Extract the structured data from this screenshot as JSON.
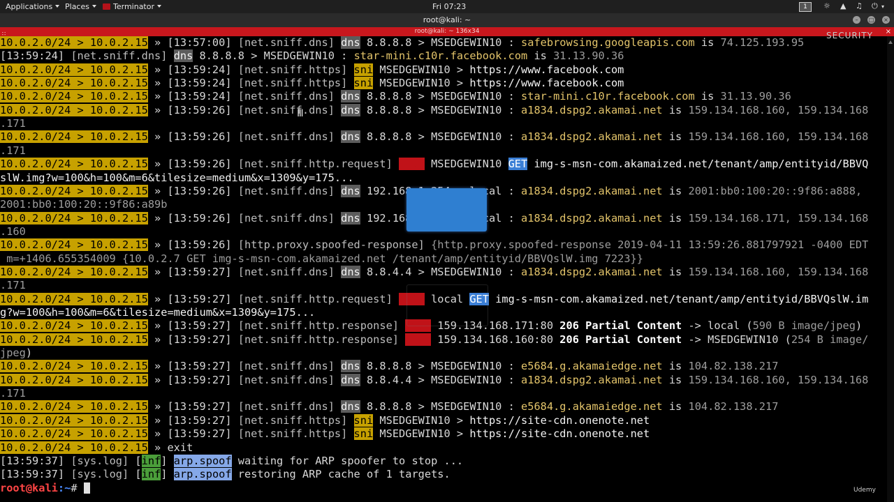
{
  "panel": {
    "applications": "Applications",
    "places": "Places",
    "terminator": "Terminator",
    "clock": "Fri 07:23",
    "workspace": "1"
  },
  "window": {
    "title": "root@kali: ~",
    "tab_title": "root@kali: ~ 136x34"
  },
  "watermark": "SECURITY",
  "udemy": "Udemy",
  "terminal_lines": [
    [
      [
        "ip",
        "10.0.2.0/24 > 10.0.2.15"
      ],
      [
        "t",
        " » [13:57:00] "
      ],
      [
        "tag",
        "[net.sniff.dns]"
      ],
      [
        "t",
        " "
      ],
      [
        "dnsb",
        "dns"
      ],
      [
        "t",
        " 8.8.8.8 > MSEDGEWIN10 : "
      ],
      [
        "host",
        "safebrowsing.googleapis.com"
      ],
      [
        "t",
        " is "
      ],
      [
        "ipg",
        "74.125.193.95"
      ]
    ],
    [
      [
        "t",
        "[13:59:24] "
      ],
      [
        "tag",
        "[net.sniff.dns]"
      ],
      [
        "t",
        " "
      ],
      [
        "dnsb",
        "dns"
      ],
      [
        "t",
        " 8.8.8.8 > MSEDGEWIN10 : "
      ],
      [
        "host",
        "star-mini.c10r.facebook.com"
      ],
      [
        "t",
        " is "
      ],
      [
        "ipg",
        "31.13.90.36"
      ]
    ],
    [
      [
        "ip",
        "10.0.2.0/24 > 10.0.2.15"
      ],
      [
        "t",
        " » [13:59:24] "
      ],
      [
        "tag",
        "[net.sniff.https]"
      ],
      [
        "t",
        " "
      ],
      [
        "snib",
        "sni"
      ],
      [
        "t",
        " MSEDGEWIN10 > "
      ],
      [
        "url",
        "https://www.facebook.com"
      ]
    ],
    [
      [
        "ip",
        "10.0.2.0/24 > 10.0.2.15"
      ],
      [
        "t",
        " » [13:59:24] "
      ],
      [
        "tag",
        "[net.sniff.https]"
      ],
      [
        "t",
        " "
      ],
      [
        "snib",
        "sni"
      ],
      [
        "t",
        " MSEDGEWIN10 > "
      ],
      [
        "url",
        "https://www.facebook.com"
      ]
    ],
    [
      [
        "ip",
        "10.0.2.0/24 > 10.0.2.15"
      ],
      [
        "t",
        " » [13:59:24] "
      ],
      [
        "tag",
        "[net.sniff.dns]"
      ],
      [
        "t",
        " "
      ],
      [
        "dnsb",
        "dns"
      ],
      [
        "t",
        " 8.8.8.8 > MSEDGEWIN10 : "
      ],
      [
        "host",
        "star-mini.c10r.facebook.com"
      ],
      [
        "t",
        " is "
      ],
      [
        "ipg",
        "31.13.90.36"
      ]
    ],
    [
      [
        "ip",
        "10.0.2.0/24 > 10.0.2.15"
      ],
      [
        "t",
        " » [13:59:26] "
      ],
      [
        "tag",
        "[net.sniff.dns]"
      ],
      [
        "t",
        " "
      ],
      [
        "dnsb",
        "dns"
      ],
      [
        "t",
        " 8.8.8.8 > MSEDGEWIN10 : "
      ],
      [
        "host",
        "a1834.dspg2.akamai.net"
      ],
      [
        "t",
        " is "
      ],
      [
        "ipg",
        "159.134.168.160, 159.134.168"
      ]
    ],
    [
      [
        "ipg",
        ".171"
      ]
    ],
    [
      [
        "ip",
        "10.0.2.0/24 > 10.0.2.15"
      ],
      [
        "t",
        " » [13:59:26] "
      ],
      [
        "tag",
        "[net.sniff.dns]"
      ],
      [
        "t",
        " "
      ],
      [
        "dnsb",
        "dns"
      ],
      [
        "t",
        " 8.8.8.8 > MSEDGEWIN10 : "
      ],
      [
        "host",
        "a1834.dspg2.akamai.net"
      ],
      [
        "t",
        " is "
      ],
      [
        "ipg",
        "159.134.168.160, 159.134.168"
      ]
    ],
    [
      [
        "ipg",
        ".171"
      ]
    ],
    [
      [
        "ip",
        "10.0.2.0/24 > 10.0.2.15"
      ],
      [
        "t",
        " » [13:59:26] "
      ],
      [
        "tag",
        "[net.sniff.http.request]"
      ],
      [
        "t",
        " "
      ],
      [
        "redb",
        "http"
      ],
      [
        "t",
        " MSEDGEWIN10 "
      ],
      [
        "getb",
        "GET"
      ],
      [
        "t",
        " "
      ],
      [
        "url",
        "img-s-msn-com.akamaized.net/tenant/amp/entityid/BBVQ"
      ]
    ],
    [
      [
        "url",
        "slW.img?w=100&h=100&m=6&tilesize=medium&x=1309&y=175..."
      ]
    ],
    [
      [
        "ip",
        "10.0.2.0/24 > 10.0.2.15"
      ],
      [
        "t",
        " » [13:59:26] "
      ],
      [
        "tag",
        "[net.sniff.dns]"
      ],
      [
        "t",
        " "
      ],
      [
        "dnsb",
        "dns"
      ],
      [
        "t",
        " 192.168.1.254 > local : "
      ],
      [
        "host",
        "a1834.dspg2.akamai.net"
      ],
      [
        "t",
        " is "
      ],
      [
        "ipg",
        "2001:bb0:100:20::9f86:a888,"
      ]
    ],
    [
      [
        "ipg",
        "2001:bb0:100:20::9f86:a89b"
      ]
    ],
    [
      [
        "ip",
        "10.0.2.0/24 > 10.0.2.15"
      ],
      [
        "t",
        " » [13:59:26] "
      ],
      [
        "tag",
        "[net.sniff.dns]"
      ],
      [
        "t",
        " "
      ],
      [
        "dnsb",
        "dns"
      ],
      [
        "t",
        " 192.168.1.254 > local : "
      ],
      [
        "host",
        "a1834.dspg2.akamai.net"
      ],
      [
        "t",
        " is "
      ],
      [
        "ipg",
        "159.134.168.171, 159.134.168"
      ]
    ],
    [
      [
        "ipg",
        ".160"
      ]
    ],
    [
      [
        "ip",
        "10.0.2.0/24 > 10.0.2.15"
      ],
      [
        "t",
        " » [13:59:26] "
      ],
      [
        "tag",
        "[http.proxy.spoofed-response]"
      ],
      [
        "t",
        " "
      ],
      [
        "ipg",
        "{http.proxy.spoofed-response 2019-04-11 13:59:26.881797921 -0400 EDT"
      ]
    ],
    [
      [
        "ipg",
        " m=+1406.655354009 {10.0.2.7 GET img-s-msn-com.akamaized.net /tenant/amp/entityid/BBVQslW.img 7223}}"
      ]
    ],
    [
      [
        "ip",
        "10.0.2.0/24 > 10.0.2.15"
      ],
      [
        "t",
        " » [13:59:27] "
      ],
      [
        "tag",
        "[net.sniff.dns]"
      ],
      [
        "t",
        " "
      ],
      [
        "dnsb",
        "dns"
      ],
      [
        "t",
        " 8.8.4.4 > MSEDGEWIN10 : "
      ],
      [
        "host",
        "a1834.dspg2.akamai.net"
      ],
      [
        "t",
        " is "
      ],
      [
        "ipg",
        "159.134.168.160, 159.134.168"
      ]
    ],
    [
      [
        "ipg",
        ".171"
      ]
    ],
    [
      [
        "ip",
        "10.0.2.0/24 > 10.0.2.15"
      ],
      [
        "t",
        " » [13:59:27] "
      ],
      [
        "tag",
        "[net.sniff.http.request]"
      ],
      [
        "t",
        " "
      ],
      [
        "redb",
        "http"
      ],
      [
        "t",
        " local "
      ],
      [
        "getb",
        "GET"
      ],
      [
        "t",
        " "
      ],
      [
        "url",
        "img-s-msn-com.akamaized.net/tenant/amp/entityid/BBVQslW.im"
      ]
    ],
    [
      [
        "url",
        "g?w=100&h=100&m=6&tilesize=medium&x=1309&y=175..."
      ]
    ],
    [
      [
        "ip",
        "10.0.2.0/24 > 10.0.2.15"
      ],
      [
        "t",
        " » [13:59:27] "
      ],
      [
        "tag",
        "[net.sniff.http.response]"
      ],
      [
        "t",
        " "
      ],
      [
        "redb",
        "http"
      ],
      [
        "t",
        " 159.134.168.171:80 "
      ],
      [
        "bold",
        "206 Partial Content"
      ],
      [
        "t",
        " -> local ("
      ],
      [
        "ipg",
        "590 B image/jpeg"
      ],
      [
        "t",
        ")"
      ]
    ],
    [
      [
        "ip",
        "10.0.2.0/24 > 10.0.2.15"
      ],
      [
        "t",
        " » [13:59:27] "
      ],
      [
        "tag",
        "[net.sniff.http.response]"
      ],
      [
        "t",
        " "
      ],
      [
        "redb",
        "http"
      ],
      [
        "t",
        " 159.134.168.160:80 "
      ],
      [
        "bold",
        "206 Partial Content"
      ],
      [
        "t",
        " -> MSEDGEWIN10 ("
      ],
      [
        "ipg",
        "254 B image/"
      ]
    ],
    [
      [
        "ipg",
        "jpeg"
      ],
      [
        "t",
        ")"
      ]
    ],
    [
      [
        "ip",
        "10.0.2.0/24 > 10.0.2.15"
      ],
      [
        "t",
        " » [13:59:27] "
      ],
      [
        "tag",
        "[net.sniff.dns]"
      ],
      [
        "t",
        " "
      ],
      [
        "dnsb",
        "dns"
      ],
      [
        "t",
        " 8.8.8.8 > MSEDGEWIN10 : "
      ],
      [
        "host",
        "e5684.g.akamaiedge.net"
      ],
      [
        "t",
        " is "
      ],
      [
        "ipg",
        "104.82.138.217"
      ]
    ],
    [
      [
        "ip",
        "10.0.2.0/24 > 10.0.2.15"
      ],
      [
        "t",
        " » [13:59:27] "
      ],
      [
        "tag",
        "[net.sniff.dns]"
      ],
      [
        "t",
        " "
      ],
      [
        "dnsb",
        "dns"
      ],
      [
        "t",
        " 8.8.4.4 > MSEDGEWIN10 : "
      ],
      [
        "host",
        "a1834.dspg2.akamai.net"
      ],
      [
        "t",
        " is "
      ],
      [
        "ipg",
        "159.134.168.160, 159.134.168"
      ]
    ],
    [
      [
        "ipg",
        ".171"
      ]
    ],
    [
      [
        "ip",
        "10.0.2.0/24 > 10.0.2.15"
      ],
      [
        "t",
        " » [13:59:27] "
      ],
      [
        "tag",
        "[net.sniff.dns]"
      ],
      [
        "t",
        " "
      ],
      [
        "dnsb",
        "dns"
      ],
      [
        "t",
        " 8.8.8.8 > MSEDGEWIN10 : "
      ],
      [
        "host",
        "e5684.g.akamaiedge.net"
      ],
      [
        "t",
        " is "
      ],
      [
        "ipg",
        "104.82.138.217"
      ]
    ],
    [
      [
        "ip",
        "10.0.2.0/24 > 10.0.2.15"
      ],
      [
        "t",
        " » [13:59:27] "
      ],
      [
        "tag",
        "[net.sniff.https]"
      ],
      [
        "t",
        " "
      ],
      [
        "snib",
        "sni"
      ],
      [
        "t",
        " MSEDGEWIN10 > "
      ],
      [
        "url",
        "https://site-cdn.onenote.net"
      ]
    ],
    [
      [
        "ip",
        "10.0.2.0/24 > 10.0.2.15"
      ],
      [
        "t",
        " » [13:59:27] "
      ],
      [
        "tag",
        "[net.sniff.https]"
      ],
      [
        "t",
        " "
      ],
      [
        "snib",
        "sni"
      ],
      [
        "t",
        " MSEDGEWIN10 > "
      ],
      [
        "url",
        "https://site-cdn.onenote.net"
      ]
    ],
    [
      [
        "ip",
        "10.0.2.0/24 > 10.0.2.15"
      ],
      [
        "t",
        " » exit"
      ]
    ],
    [
      [
        "t",
        "[13:59:37] "
      ],
      [
        "tag",
        "[sys.log]"
      ],
      [
        "t",
        " ["
      ],
      [
        "infb",
        "inf"
      ],
      [
        "t",
        "] "
      ],
      [
        "arpb",
        "arp.spoof"
      ],
      [
        "t",
        " waiting for ARP spoofer to stop ..."
      ]
    ],
    [
      [
        "t",
        "[13:59:37] "
      ],
      [
        "tag",
        "[sys.log]"
      ],
      [
        "t",
        " ["
      ],
      [
        "infb",
        "inf"
      ],
      [
        "t",
        "] "
      ],
      [
        "arpb",
        "arp.spoof"
      ],
      [
        "t",
        " restoring ARP cache of 1 targets."
      ]
    ]
  ],
  "prompt": {
    "user_host": "root@kali",
    "path": ":~",
    "symbol": "# "
  }
}
